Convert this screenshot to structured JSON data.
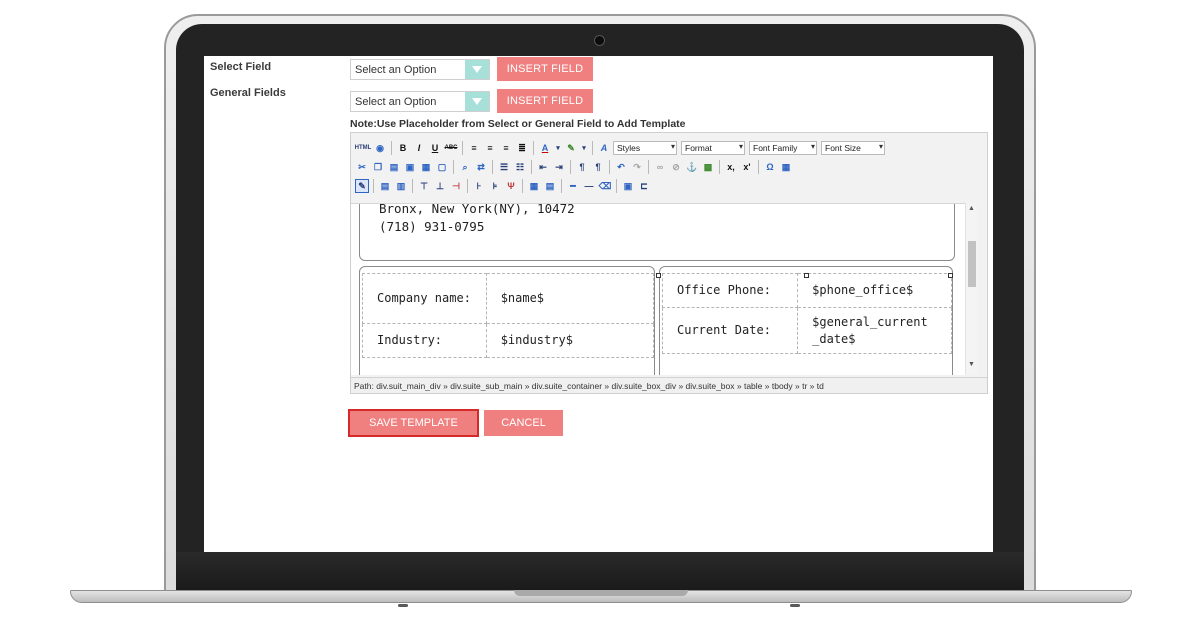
{
  "form": {
    "select_field_label": "Select Field",
    "general_fields_label": "General Fields",
    "select_placeholder_1": "Select an Option",
    "select_placeholder_2": "Select an Option",
    "insert_field_label_1": "INSERT FIELD",
    "insert_field_label_2": "INSERT FIELD",
    "note": "Note:Use Placeholder from Select or General Field to Add Template"
  },
  "toolbar": {
    "styles": "Styles",
    "format": "Format",
    "font_family": "Font Family",
    "font_size": "Font Size",
    "html_label": "HTML",
    "bold": "B",
    "italic": "I",
    "underline": "U",
    "strike": "ABC",
    "subscript": "x,",
    "superscript": "x'",
    "omega": "Ω"
  },
  "content": {
    "address_line_1": "Bronx, New York(NY), 10472",
    "address_line_2": "(718) 931-0795",
    "left_table": [
      {
        "label": "Company name:",
        "value": "$name$"
      },
      {
        "label": "Industry:",
        "value": "$industry$"
      }
    ],
    "right_table": [
      {
        "label": "Office Phone:",
        "value": "$phone_office$"
      },
      {
        "label": "Current Date:",
        "value": "$general_current _date$"
      }
    ]
  },
  "path_bar": "Path: div.suit_main_div » div.suite_sub_main » div.suite_container » div.suite_box_div » div.suite_box » table » tbody » tr » td",
  "actions": {
    "save": "SAVE TEMPLATE",
    "cancel": "CANCEL"
  },
  "colors": {
    "accent_button": "#f08080",
    "select_arrow": "#a6e0d8",
    "save_outline": "#d42a2a"
  }
}
